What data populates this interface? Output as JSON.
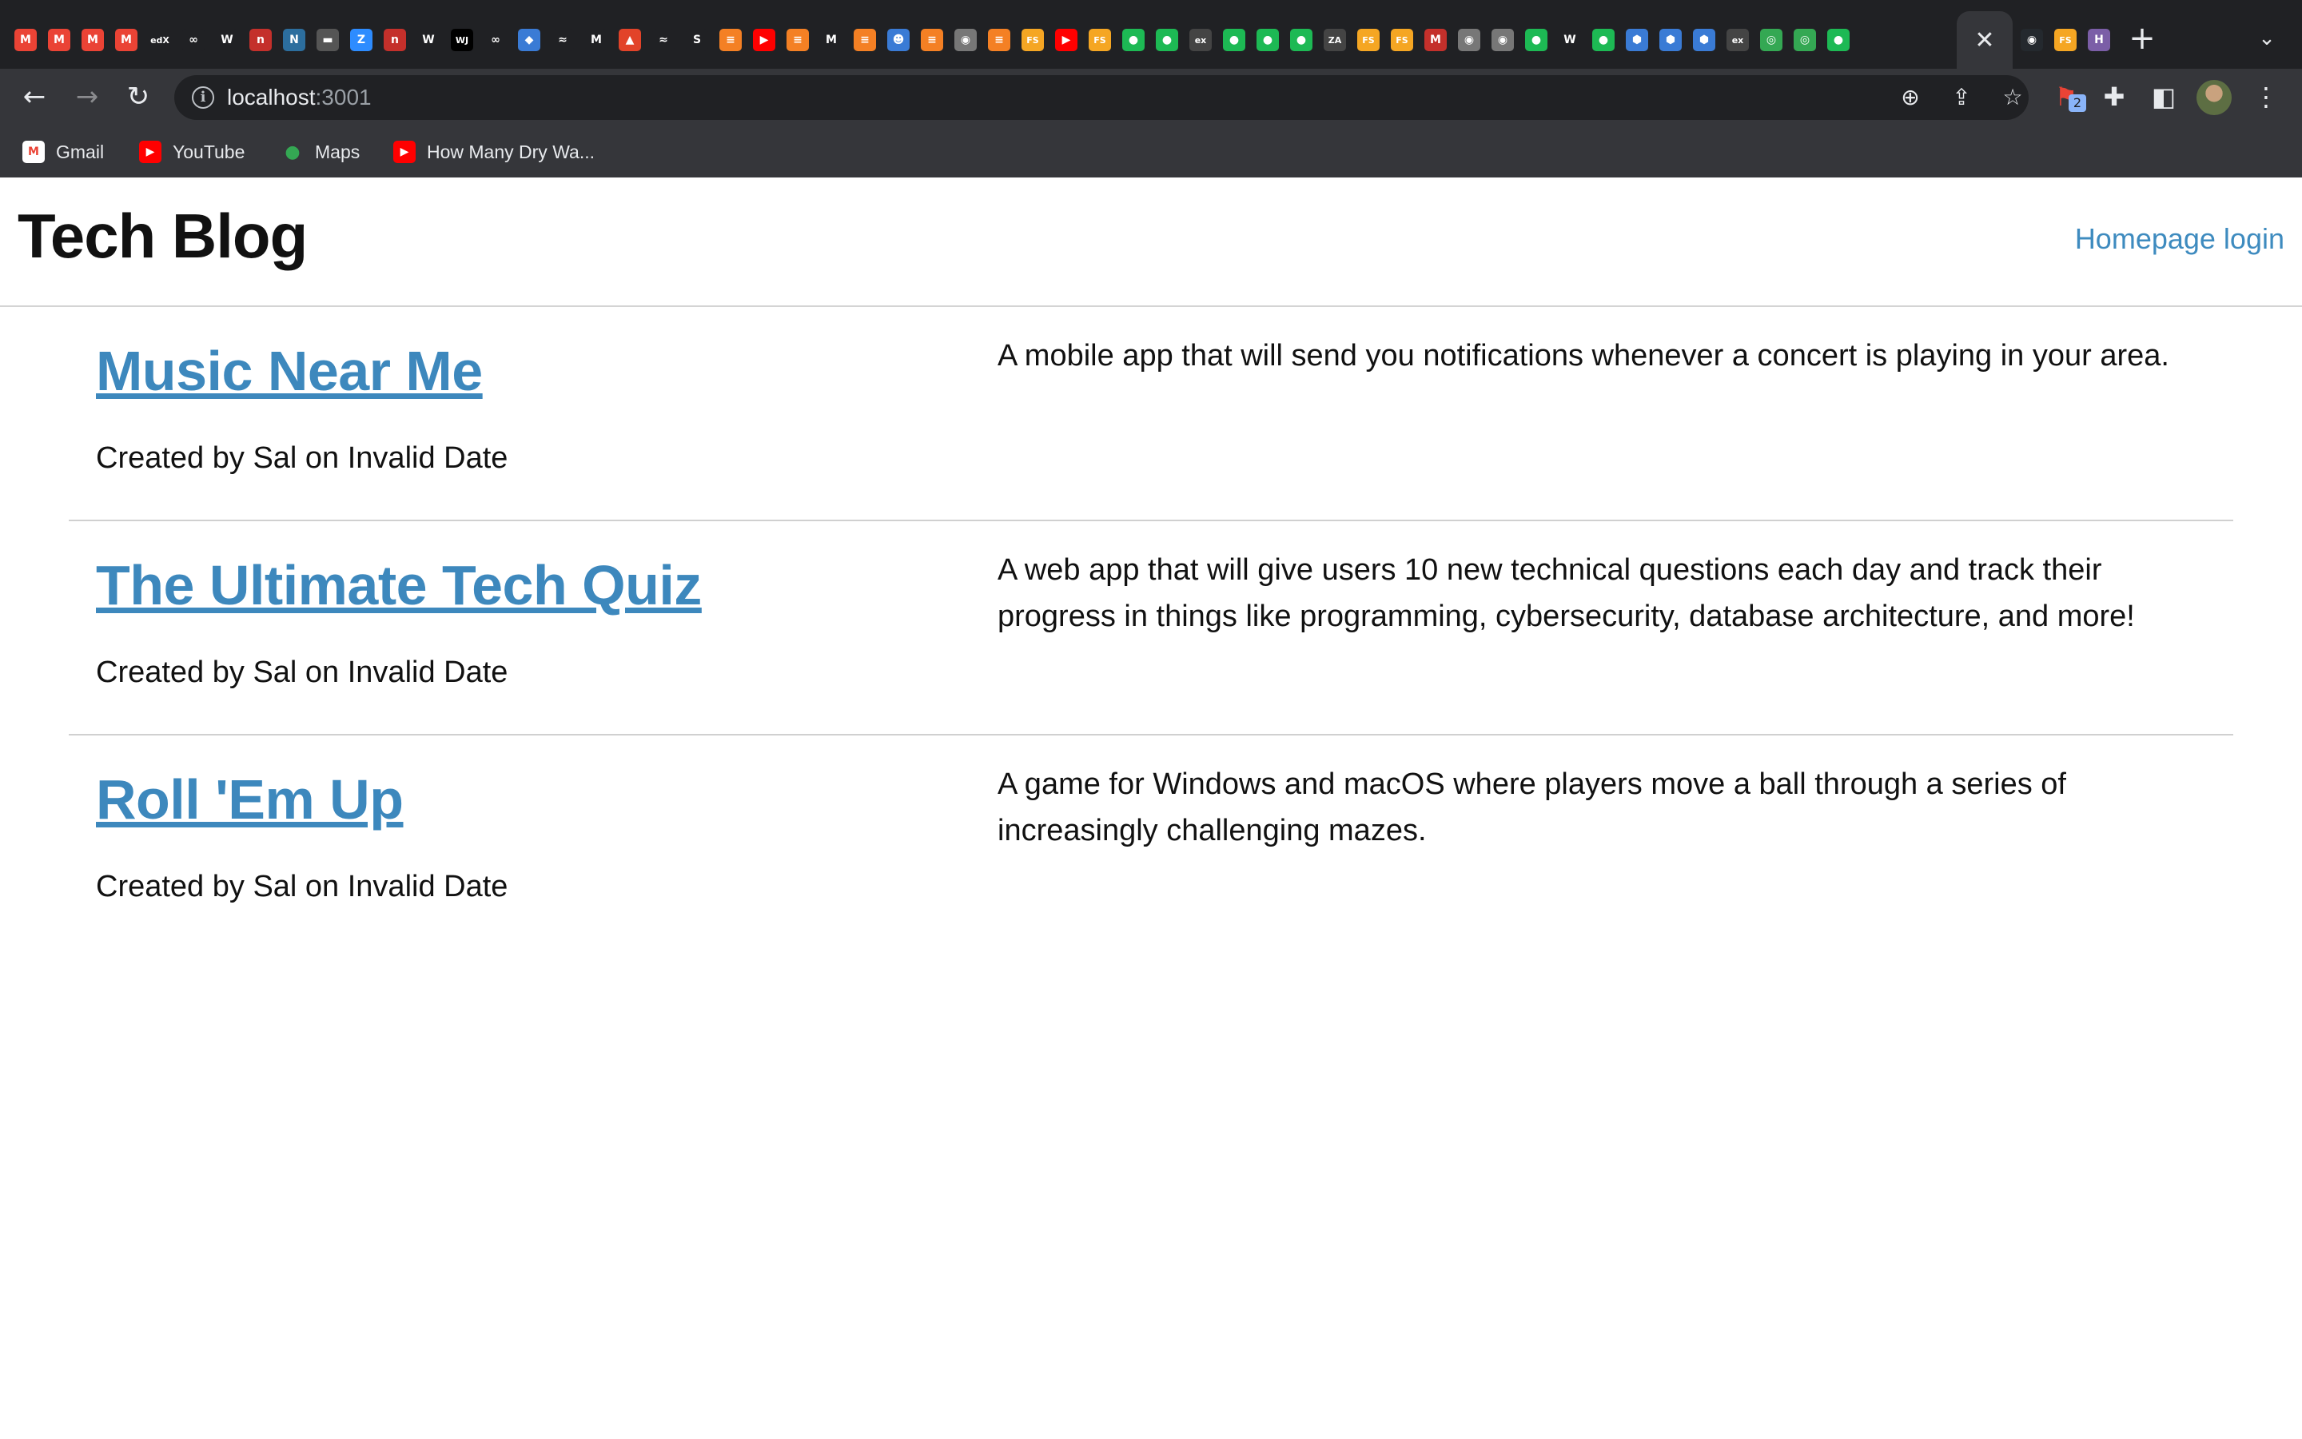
{
  "browser": {
    "url_host": "localhost",
    "url_port": ":3001",
    "tab_close_glyph": "✕",
    "new_tab_glyph": "+",
    "extension_badge_count": "2",
    "bookmarks": [
      {
        "label": "Gmail",
        "icon": "gmail-icon",
        "color": "#ea4335",
        "glyph": "M"
      },
      {
        "label": "YouTube",
        "icon": "youtube-icon",
        "color": "#ff0000",
        "glyph": "▶"
      },
      {
        "label": "Maps",
        "icon": "maps-icon",
        "color": "#34a853",
        "glyph": "●"
      },
      {
        "label": "How Many Dry Wa...",
        "icon": "youtube-icon",
        "color": "#ff0000",
        "glyph": "▶"
      }
    ],
    "tab_favicons": [
      {
        "glyph": "M",
        "color": "#ea4335"
      },
      {
        "glyph": "M",
        "color": "#ea4335"
      },
      {
        "glyph": "M",
        "color": "#ea4335"
      },
      {
        "glyph": "M",
        "color": "#ea4335"
      },
      {
        "glyph": "edX",
        "color": "#202124"
      },
      {
        "glyph": "∞",
        "color": "#202124"
      },
      {
        "glyph": "W",
        "color": "#202124"
      },
      {
        "glyph": "n",
        "color": "#c4302b"
      },
      {
        "glyph": "N",
        "color": "#2c6e9e"
      },
      {
        "glyph": "▬",
        "color": "#555"
      },
      {
        "glyph": "Z",
        "color": "#2d8cff"
      },
      {
        "glyph": "n",
        "color": "#c4302b"
      },
      {
        "glyph": "W",
        "color": "#202124"
      },
      {
        "glyph": "WJ",
        "color": "#000"
      },
      {
        "glyph": "∞",
        "color": "#202124"
      },
      {
        "glyph": "◆",
        "color": "#3a7bd5"
      },
      {
        "glyph": "≈",
        "color": "#202124"
      },
      {
        "glyph": "M",
        "color": "#202124"
      },
      {
        "glyph": "▲",
        "color": "#e24329"
      },
      {
        "glyph": "≈",
        "color": "#202124"
      },
      {
        "glyph": "S",
        "color": "#202124"
      },
      {
        "glyph": "≡",
        "color": "#f48024"
      },
      {
        "glyph": "▶",
        "color": "#ff0000"
      },
      {
        "glyph": "≡",
        "color": "#f48024"
      },
      {
        "glyph": "M",
        "color": "#202124"
      },
      {
        "glyph": "≡",
        "color": "#f48024"
      },
      {
        "glyph": "☻",
        "color": "#3a7bd5"
      },
      {
        "glyph": "≡",
        "color": "#f48024"
      },
      {
        "glyph": "◉",
        "color": "#777"
      },
      {
        "glyph": "≡",
        "color": "#f48024"
      },
      {
        "glyph": "FS",
        "color": "#f5a623"
      },
      {
        "glyph": "▶",
        "color": "#ff0000"
      },
      {
        "glyph": "FS",
        "color": "#f5a623"
      },
      {
        "glyph": "●",
        "color": "#1db954"
      },
      {
        "glyph": "●",
        "color": "#1db954"
      },
      {
        "glyph": "ex",
        "color": "#444"
      },
      {
        "glyph": "●",
        "color": "#1db954"
      },
      {
        "glyph": "●",
        "color": "#1db954"
      },
      {
        "glyph": "●",
        "color": "#1db954"
      },
      {
        "glyph": "ZA",
        "color": "#444"
      },
      {
        "glyph": "FS",
        "color": "#f5a623"
      },
      {
        "glyph": "FS",
        "color": "#f5a623"
      },
      {
        "glyph": "M",
        "color": "#c4302b"
      },
      {
        "glyph": "◉",
        "color": "#777"
      },
      {
        "glyph": "◉",
        "color": "#777"
      },
      {
        "glyph": "●",
        "color": "#1db954"
      },
      {
        "glyph": "W",
        "color": "#202124"
      },
      {
        "glyph": "●",
        "color": "#1db954"
      },
      {
        "glyph": "⬢",
        "color": "#3a7bd5"
      },
      {
        "glyph": "⬢",
        "color": "#3a7bd5"
      },
      {
        "glyph": "⬢",
        "color": "#3a7bd5"
      },
      {
        "glyph": "ex",
        "color": "#444"
      },
      {
        "glyph": "◎",
        "color": "#34a853"
      },
      {
        "glyph": "◎",
        "color": "#34a853"
      },
      {
        "glyph": "●",
        "color": "#1db954"
      }
    ],
    "after_active_favicons": [
      {
        "glyph": "◉",
        "color": "#24292e"
      },
      {
        "glyph": "FS",
        "color": "#f5a623"
      },
      {
        "glyph": "H",
        "color": "#7b5ea7"
      }
    ]
  },
  "site": {
    "title": "Tech Blog",
    "login_link": "Homepage login",
    "link_color": "#3d88bd"
  },
  "posts": [
    {
      "title": "Music Near Me",
      "meta": "Created by Sal on Invalid Date",
      "description": "A mobile app that will send you notifications whenever a concert is playing in your area."
    },
    {
      "title": "The Ultimate Tech Quiz",
      "meta": "Created by Sal on Invalid Date",
      "description": "A web app that will give users 10 new technical questions each day and track their progress in things like programming, cybersecurity, database architecture, and more!"
    },
    {
      "title": "Roll 'Em Up",
      "meta": "Created by Sal on Invalid Date",
      "description": "A game for Windows and macOS where players move a ball through a series of increasingly challenging mazes."
    }
  ]
}
